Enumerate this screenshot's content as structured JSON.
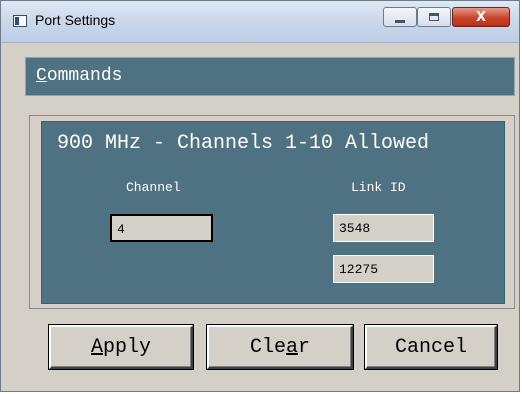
{
  "window": {
    "title": "Port Settings",
    "controls": {
      "minimize_icon": "minimize-icon",
      "maximize_icon": "maximize-icon",
      "close_icon": "close-icon",
      "close_glyph": "X"
    }
  },
  "menubar": {
    "items": [
      {
        "label_underlined": "C",
        "label_rest": "ommands"
      }
    ]
  },
  "panel": {
    "title": "900 MHz - Channels 1-10 Allowed",
    "channel_label": "Channel",
    "link_id_label": "Link ID",
    "channel_value": "4",
    "link_id_values": [
      "3548",
      "12275"
    ]
  },
  "buttons": {
    "apply": {
      "underlined": "A",
      "rest": "pply"
    },
    "clear": {
      "before": "Cle",
      "underlined": "a",
      "after": "r"
    },
    "cancel": {
      "label": "Cancel"
    }
  },
  "colors": {
    "panel_bg": "#4f7282",
    "dialog_bg": "#d4d0c8",
    "close_button": "#c8442a"
  }
}
